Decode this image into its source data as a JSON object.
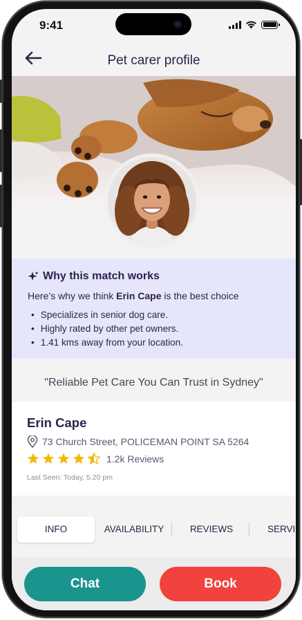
{
  "status_bar": {
    "time": "9:41"
  },
  "header": {
    "title": "Pet carer profile"
  },
  "match": {
    "title": "Why this match works",
    "intro_before": "Here’s why we think ",
    "intro_name": "Erin Cape",
    "intro_after": " is the best choice",
    "reasons": [
      "Specializes in senior dog care.",
      "Highly rated by other pet owners.",
      "1.41 kms away from your location."
    ]
  },
  "tagline": "\"Reliable Pet Care You Can Trust in Sydney\"",
  "profile": {
    "name": "Erin Cape",
    "address": "73 Church Street, POLICEMAN POINT SA 5264",
    "rating": 4.5,
    "reviews": "1.2k Reviews",
    "last_seen": "Last Seen: Today, 5.20 pm"
  },
  "tabs": [
    "INFO",
    "AVAILABILITY",
    "REVIEWS",
    "SERVICES"
  ],
  "active_tab": "INFO",
  "actions": {
    "chat": "Chat",
    "book": "Book"
  },
  "colors": {
    "primary_text": "#2d1f4a",
    "chat": "#1a958d",
    "book": "#f1423d",
    "match_bg": "#e5e6fb",
    "star": "#f2b90c"
  }
}
